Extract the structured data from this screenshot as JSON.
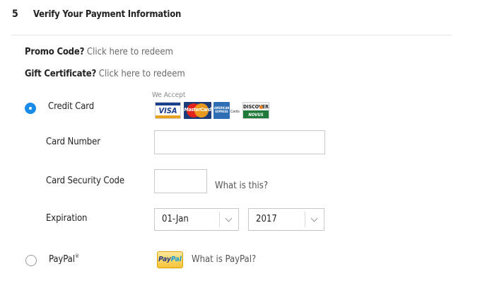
{
  "section": {
    "number": "5",
    "title": "Verify Your Payment Information"
  },
  "promo": {
    "label": "Promo Code?",
    "link": "Click here to redeem"
  },
  "gift": {
    "label": "Gift Certificate?",
    "link": "Click here to redeem"
  },
  "credit_card": {
    "label": "Credit Card",
    "selected": true,
    "we_accept": "We Accept",
    "cards": {
      "visa": "VISA",
      "mastercard": "MasterCard",
      "amex": "AMERICAN EXPRESS",
      "amex_suffix": "Cards",
      "discover": "DISCOVER",
      "novus": "NOVUS"
    },
    "card_number_label": "Card Number",
    "card_number_value": "",
    "csc_label": "Card Security Code",
    "csc_value": "",
    "csc_help": "What is this?",
    "expiration_label": "Expiration",
    "expiration_month": "01-Jan",
    "expiration_year": "2017"
  },
  "paypal": {
    "label": "PayPal",
    "trademark": "®",
    "selected": false,
    "logo_part1": "Pay",
    "logo_part2": "Pal",
    "help": "What is PayPal?"
  },
  "colors": {
    "radio_selected": "#1a8ce8",
    "text": "#222222",
    "link": "#6a6a6a"
  },
  "icons": [
    "radio-checked-icon",
    "visa-logo-icon",
    "mastercard-logo-icon",
    "amex-logo-icon",
    "discover-novus-logo-icon",
    "chevron-down-icon",
    "paypal-logo-icon",
    "radio-unchecked-icon"
  ]
}
